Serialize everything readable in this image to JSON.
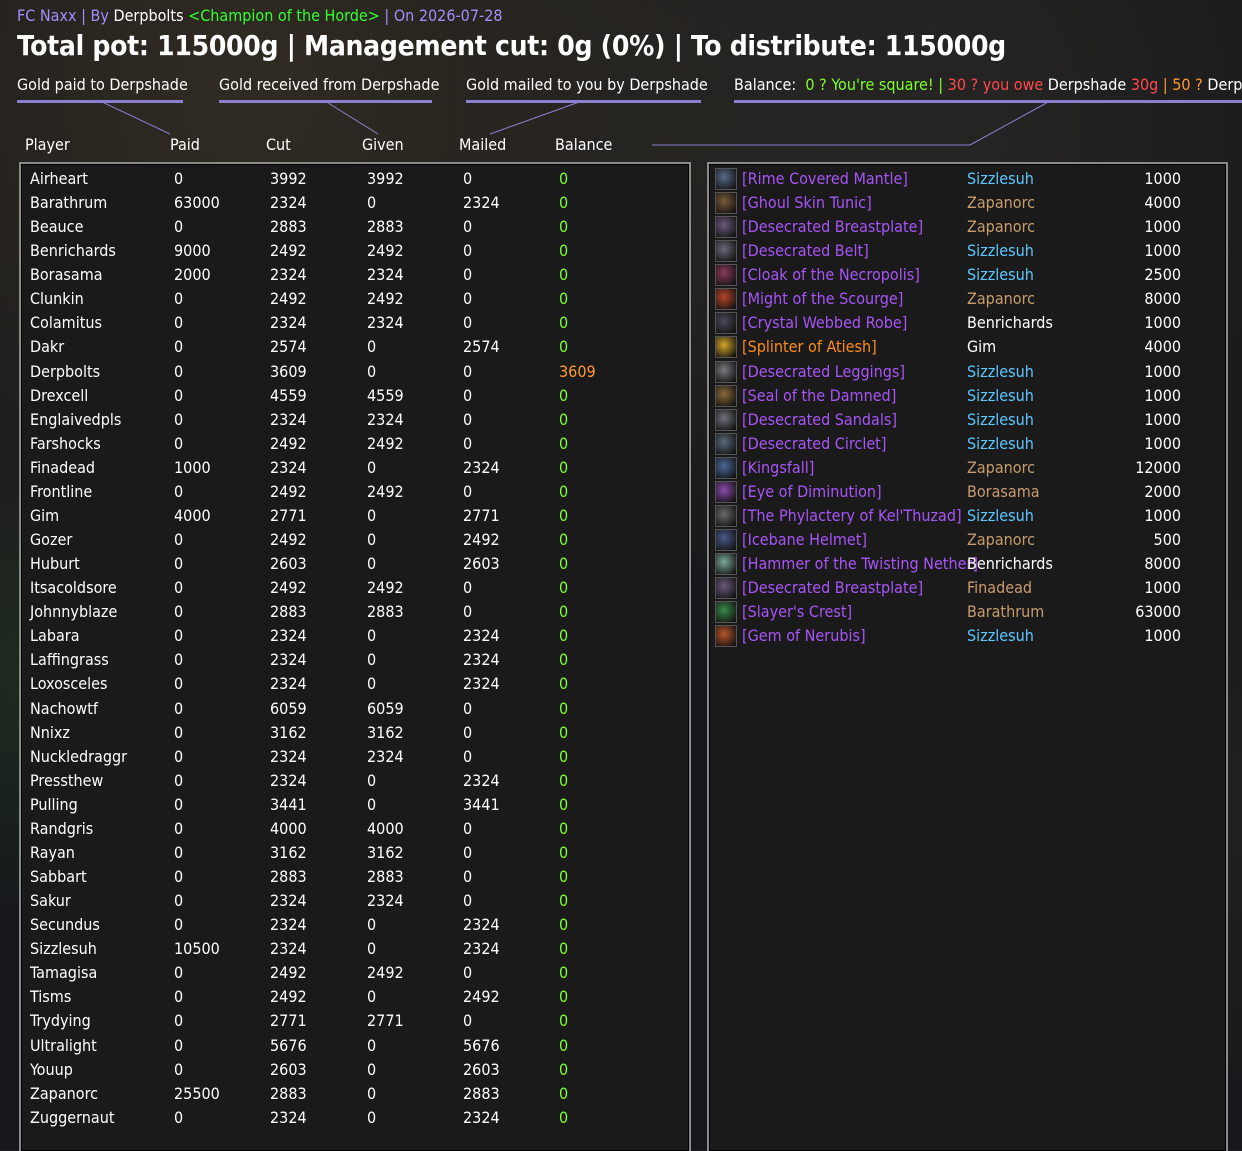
{
  "header": {
    "guild": "FC Naxx",
    "sep1": " | By ",
    "author": "Derpbolts",
    "title_tag": "<Champion of the Horde>",
    "sep2": " | On ",
    "date": "2026-07-28"
  },
  "summary": {
    "text": "Total pot: 115000g | Management cut: 0g (0%) | To distribute: 115000g"
  },
  "tabs": [
    {
      "label": "Gold paid to Derpshade"
    },
    {
      "label": "Gold received from Derpshade"
    },
    {
      "label": "Gold mailed to you by Derpshade"
    }
  ],
  "balance_bar": {
    "label": "Balance:",
    "square_key": "0 ? You're square!",
    "sep": "  |  ",
    "owe_key": "30 ? you owe",
    "owe_name": "Derpshade",
    "owe_amount": "30g",
    "sep2": "  |  ",
    "owed_key": "50 ?",
    "owed_name": "Derpshade owes you"
  },
  "columns": {
    "player": "Player",
    "paid": "Paid",
    "cut": "Cut",
    "given": "Given",
    "mailed": "Mailed",
    "balance": "Balance"
  },
  "colors": {
    "accent_purple": "#8b7fd0",
    "balance_zero": "#7cff2a",
    "balance_positive": "#ff9a2e",
    "epic": "#a855f7",
    "legendary": "#ff8c1a"
  },
  "players": [
    {
      "name": "Airheart",
      "paid": "0",
      "cut": "3992",
      "given": "3992",
      "mailed": "0",
      "balance": "0"
    },
    {
      "name": "Barathrum",
      "paid": "63000",
      "cut": "2324",
      "given": "0",
      "mailed": "2324",
      "balance": "0"
    },
    {
      "name": "Beauce",
      "paid": "0",
      "cut": "2883",
      "given": "2883",
      "mailed": "0",
      "balance": "0"
    },
    {
      "name": "Benrichards",
      "paid": "9000",
      "cut": "2492",
      "given": "2492",
      "mailed": "0",
      "balance": "0"
    },
    {
      "name": "Borasama",
      "paid": "2000",
      "cut": "2324",
      "given": "2324",
      "mailed": "0",
      "balance": "0"
    },
    {
      "name": "Clunkin",
      "paid": "0",
      "cut": "2492",
      "given": "2492",
      "mailed": "0",
      "balance": "0"
    },
    {
      "name": "Colamitus",
      "paid": "0",
      "cut": "2324",
      "given": "2324",
      "mailed": "0",
      "balance": "0"
    },
    {
      "name": "Dakr",
      "paid": "0",
      "cut": "2574",
      "given": "0",
      "mailed": "2574",
      "balance": "0"
    },
    {
      "name": "Derpbolts",
      "paid": "0",
      "cut": "3609",
      "given": "0",
      "mailed": "0",
      "balance": "3609"
    },
    {
      "name": "Drexcell",
      "paid": "0",
      "cut": "4559",
      "given": "4559",
      "mailed": "0",
      "balance": "0"
    },
    {
      "name": "Englaivedpls",
      "paid": "0",
      "cut": "2324",
      "given": "2324",
      "mailed": "0",
      "balance": "0"
    },
    {
      "name": "Farshocks",
      "paid": "0",
      "cut": "2492",
      "given": "2492",
      "mailed": "0",
      "balance": "0"
    },
    {
      "name": "Finadead",
      "paid": "1000",
      "cut": "2324",
      "given": "0",
      "mailed": "2324",
      "balance": "0"
    },
    {
      "name": "Frontline",
      "paid": "0",
      "cut": "2492",
      "given": "2492",
      "mailed": "0",
      "balance": "0"
    },
    {
      "name": "Gim",
      "paid": "4000",
      "cut": "2771",
      "given": "0",
      "mailed": "2771",
      "balance": "0"
    },
    {
      "name": "Gozer",
      "paid": "0",
      "cut": "2492",
      "given": "0",
      "mailed": "2492",
      "balance": "0"
    },
    {
      "name": "Huburt",
      "paid": "0",
      "cut": "2603",
      "given": "0",
      "mailed": "2603",
      "balance": "0"
    },
    {
      "name": "Itsacoldsore",
      "paid": "0",
      "cut": "2492",
      "given": "2492",
      "mailed": "0",
      "balance": "0"
    },
    {
      "name": "Johnnyblaze",
      "paid": "0",
      "cut": "2883",
      "given": "2883",
      "mailed": "0",
      "balance": "0"
    },
    {
      "name": "Labara",
      "paid": "0",
      "cut": "2324",
      "given": "0",
      "mailed": "2324",
      "balance": "0"
    },
    {
      "name": "Laffingrass",
      "paid": "0",
      "cut": "2324",
      "given": "0",
      "mailed": "2324",
      "balance": "0"
    },
    {
      "name": "Loxosceles",
      "paid": "0",
      "cut": "2324",
      "given": "0",
      "mailed": "2324",
      "balance": "0"
    },
    {
      "name": "Nachowtf",
      "paid": "0",
      "cut": "6059",
      "given": "6059",
      "mailed": "0",
      "balance": "0"
    },
    {
      "name": "Nnixz",
      "paid": "0",
      "cut": "3162",
      "given": "3162",
      "mailed": "0",
      "balance": "0"
    },
    {
      "name": "Nuckledraggr",
      "paid": "0",
      "cut": "2324",
      "given": "2324",
      "mailed": "0",
      "balance": "0"
    },
    {
      "name": "Pressthew",
      "paid": "0",
      "cut": "2324",
      "given": "0",
      "mailed": "2324",
      "balance": "0"
    },
    {
      "name": "Pulling",
      "paid": "0",
      "cut": "3441",
      "given": "0",
      "mailed": "3441",
      "balance": "0"
    },
    {
      "name": "Randgris",
      "paid": "0",
      "cut": "4000",
      "given": "4000",
      "mailed": "0",
      "balance": "0"
    },
    {
      "name": "Rayan",
      "paid": "0",
      "cut": "3162",
      "given": "3162",
      "mailed": "0",
      "balance": "0"
    },
    {
      "name": "Sabbart",
      "paid": "0",
      "cut": "2883",
      "given": "2883",
      "mailed": "0",
      "balance": "0"
    },
    {
      "name": "Sakur",
      "paid": "0",
      "cut": "2324",
      "given": "2324",
      "mailed": "0",
      "balance": "0"
    },
    {
      "name": "Secundus",
      "paid": "0",
      "cut": "2324",
      "given": "0",
      "mailed": "2324",
      "balance": "0"
    },
    {
      "name": "Sizzlesuh",
      "paid": "10500",
      "cut": "2324",
      "given": "0",
      "mailed": "2324",
      "balance": "0"
    },
    {
      "name": "Tamagisa",
      "paid": "0",
      "cut": "2492",
      "given": "2492",
      "mailed": "0",
      "balance": "0"
    },
    {
      "name": "Tisms",
      "paid": "0",
      "cut": "2492",
      "given": "0",
      "mailed": "2492",
      "balance": "0"
    },
    {
      "name": "Trydying",
      "paid": "0",
      "cut": "2771",
      "given": "2771",
      "mailed": "0",
      "balance": "0"
    },
    {
      "name": "Ultralight",
      "paid": "0",
      "cut": "5676",
      "given": "0",
      "mailed": "5676",
      "balance": "0"
    },
    {
      "name": "Youup",
      "paid": "0",
      "cut": "2603",
      "given": "0",
      "mailed": "2603",
      "balance": "0"
    },
    {
      "name": "Zapanorc",
      "paid": "25500",
      "cut": "2883",
      "given": "0",
      "mailed": "2883",
      "balance": "0"
    },
    {
      "name": "Zuggernaut",
      "paid": "0",
      "cut": "2324",
      "given": "0",
      "mailed": "2324",
      "balance": "0"
    }
  ],
  "items": [
    {
      "name": "[Rime Covered Mantle]",
      "quality": "epic",
      "buyer": "Sizzlesuh",
      "buyer_color": "blue",
      "price": "1000",
      "icon": "mantle-icon",
      "icon_color": "#5a6b8a"
    },
    {
      "name": "[Ghoul Skin Tunic]",
      "quality": "epic",
      "buyer": "Zapanorc",
      "buyer_color": "tan",
      "price": "4000",
      "icon": "tunic-icon",
      "icon_color": "#7a5a3a"
    },
    {
      "name": "[Desecrated Breastplate]",
      "quality": "epic",
      "buyer": "Zapanorc",
      "buyer_color": "tan",
      "price": "1000",
      "icon": "breastplate-icon",
      "icon_color": "#6a5a7a"
    },
    {
      "name": "[Desecrated Belt]",
      "quality": "epic",
      "buyer": "Sizzlesuh",
      "buyer_color": "blue",
      "price": "1000",
      "icon": "belt-icon",
      "icon_color": "#6a6a7a"
    },
    {
      "name": "[Cloak of the Necropolis]",
      "quality": "epic",
      "buyer": "Sizzlesuh",
      "buyer_color": "blue",
      "price": "2500",
      "icon": "cloak-icon",
      "icon_color": "#8a3a5a"
    },
    {
      "name": "[Might of the Scourge]",
      "quality": "epic",
      "buyer": "Zapanorc",
      "buyer_color": "tan",
      "price": "8000",
      "icon": "enchant-icon",
      "icon_color": "#b8452a"
    },
    {
      "name": "[Crystal Webbed Robe]",
      "quality": "epic",
      "buyer": "Benrichards",
      "buyer_color": "white",
      "price": "1000",
      "icon": "robe-icon",
      "icon_color": "#4a4a5a"
    },
    {
      "name": "[Splinter of Atiesh]",
      "quality": "legendary",
      "buyer": "Gim",
      "buyer_color": "white",
      "price": "4000",
      "icon": "splinter-icon",
      "icon_color": "#d4a52a"
    },
    {
      "name": "[Desecrated Leggings]",
      "quality": "epic",
      "buyer": "Sizzlesuh",
      "buyer_color": "blue",
      "price": "1000",
      "icon": "leggings-icon",
      "icon_color": "#7a7a80"
    },
    {
      "name": "[Seal of the Damned]",
      "quality": "epic",
      "buyer": "Sizzlesuh",
      "buyer_color": "blue",
      "price": "1000",
      "icon": "ring-icon",
      "icon_color": "#8a6a3a"
    },
    {
      "name": "[Desecrated Sandals]",
      "quality": "epic",
      "buyer": "Sizzlesuh",
      "buyer_color": "blue",
      "price": "1000",
      "icon": "sandals-icon",
      "icon_color": "#70707a"
    },
    {
      "name": "[Desecrated Circlet]",
      "quality": "epic",
      "buyer": "Sizzlesuh",
      "buyer_color": "blue",
      "price": "1000",
      "icon": "circlet-icon",
      "icon_color": "#5a6a7a"
    },
    {
      "name": "[Kingsfall]",
      "quality": "epic",
      "buyer": "Zapanorc",
      "buyer_color": "tan",
      "price": "12000",
      "icon": "dagger-icon",
      "icon_color": "#4a6a9a"
    },
    {
      "name": "[Eye of Diminution]",
      "quality": "epic",
      "buyer": "Borasama",
      "buyer_color": "tan",
      "price": "2000",
      "icon": "trinket-icon",
      "icon_color": "#8a4aaa"
    },
    {
      "name": "[The Phylactery of Kel'Thuzad]",
      "quality": "epic",
      "buyer": "Sizzlesuh",
      "buyer_color": "blue",
      "price": "1000",
      "icon": "phylactery-icon",
      "icon_color": "#6a6a6a"
    },
    {
      "name": "[Icebane Helmet]",
      "quality": "epic",
      "buyer": "Zapanorc",
      "buyer_color": "tan",
      "price": "500",
      "icon": "helmet-icon",
      "icon_color": "#4a5a8a"
    },
    {
      "name": "[Hammer of the Twisting Nether]",
      "quality": "epic",
      "buyer": "Benrichards",
      "buyer_color": "white",
      "price": "8000",
      "icon": "hammer-icon",
      "icon_color": "#7aaa9a"
    },
    {
      "name": "[Desecrated Breastplate]",
      "quality": "epic",
      "buyer": "Finadead",
      "buyer_color": "tan",
      "price": "1000",
      "icon": "breastplate-icon",
      "icon_color": "#6a5a7a"
    },
    {
      "name": "[Slayer's Crest]",
      "quality": "epic",
      "buyer": "Barathrum",
      "buyer_color": "tan",
      "price": "63000",
      "icon": "crest-icon",
      "icon_color": "#3a8a4a"
    },
    {
      "name": "[Gem of Nerubis]",
      "quality": "epic",
      "buyer": "Sizzlesuh",
      "buyer_color": "blue",
      "price": "1000",
      "icon": "gem-icon",
      "icon_color": "#b8552a"
    }
  ]
}
